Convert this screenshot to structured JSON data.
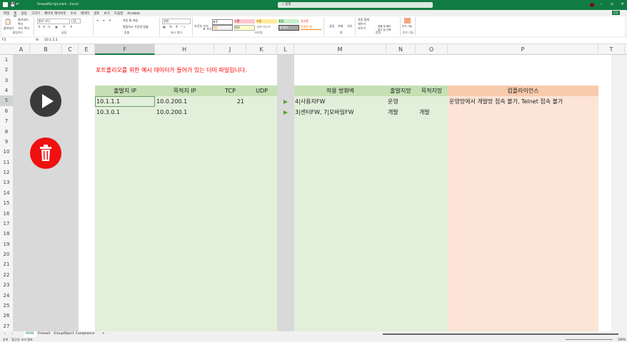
{
  "title": {
    "file": "firewallScript.xlsm - Excel",
    "search_placeholder": "검색"
  },
  "menu": [
    "파일",
    "홈",
    "삽입",
    "그리기",
    "페이지 레이아웃",
    "수식",
    "데이터",
    "검토",
    "보기",
    "도움말",
    "Acrobat"
  ],
  "share": "공유",
  "ribbon": {
    "clipboard": {
      "paste": "붙여넣기",
      "cut": "잘라내기",
      "copy": "복사",
      "format_painter": "서식 복사",
      "label": "클립보드"
    },
    "font": {
      "name": "맑은 고딕",
      "size": "11",
      "label": "글꼴"
    },
    "align": {
      "wrap": "자동 줄 바꿈",
      "merge": "병합하고 가운데 맞춤",
      "label": "맞춤"
    },
    "number": {
      "format": "일반",
      "label": "표시 형식"
    },
    "styles": {
      "conditional": "조건부 서식",
      "table": "표 서식",
      "items": [
        "표준",
        "나쁨",
        "보통",
        "좋음",
        "경고문",
        "계산",
        "메모",
        "설명 텍스트",
        "셀 확인",
        "연결된 셀"
      ],
      "label": "스타일"
    },
    "cells": {
      "insert": "삽입",
      "delete": "삭제",
      "format": "서식",
      "label": "셀"
    },
    "editing": {
      "autosum": "자동 합계",
      "fill": "채우기",
      "clear": "지우기",
      "sort": "정렬 및 필터",
      "find": "찾기 및 선택",
      "label": "편집"
    },
    "addins": {
      "btn": "추가 기능",
      "label": "추가 기능"
    }
  },
  "formula": {
    "namebox": "F5",
    "fx": "fx",
    "value": "10.1.1.1"
  },
  "columns": [
    "A",
    "B",
    "C",
    "E",
    "F",
    "H",
    "J",
    "K",
    "L",
    "M",
    "N",
    "O",
    "P",
    "T"
  ],
  "rows": [
    "1",
    "2",
    "3",
    "4",
    "5",
    "6",
    "7",
    "8",
    "9",
    "10",
    "11",
    "12",
    "13",
    "14",
    "15",
    "16",
    "17",
    "18",
    "19",
    "20",
    "21",
    "22",
    "23",
    "24",
    "25",
    "26",
    "27"
  ],
  "sheet": {
    "note": "포트폴리오를 위한 예시 데이터가 들어가 있는 더미 파일입니다.",
    "left_headers": [
      "출발지 IP",
      "목적지 IP",
      "TCP",
      "UDP"
    ],
    "left_rows": [
      [
        "10.1.1.1",
        "10.0.200.1",
        "21",
        ""
      ],
      [
        "10.3.0.1",
        "10.0.200.1",
        "",
        ""
      ]
    ],
    "right_headers": [
      "적용 방화벽",
      "출발지망",
      "목적지망"
    ],
    "right_rows": [
      [
        "4|사용자FW",
        "운영",
        ""
      ],
      [
        "3|센터FW, 7|모바일FW",
        "개발",
        "개발"
      ]
    ],
    "compliance_header": "컴플라이언스",
    "compliance_rows": [
      "운영망에서 개발망 접속 불가, Telnet 접속 불가",
      ""
    ]
  },
  "tabs": [
    "MAIN",
    "Firewall",
    "GroupObject",
    "Compliance"
  ],
  "status": {
    "ready": "준비",
    "accessibility": "접근성: 조사 필요",
    "zoom": "100%"
  },
  "colors": {
    "green": "#107c41",
    "header_green": "#c6e0b4",
    "body_green": "#e2efda",
    "header_orange": "#f8cbad",
    "body_orange": "#fce4d6",
    "red": "#ff0000"
  }
}
